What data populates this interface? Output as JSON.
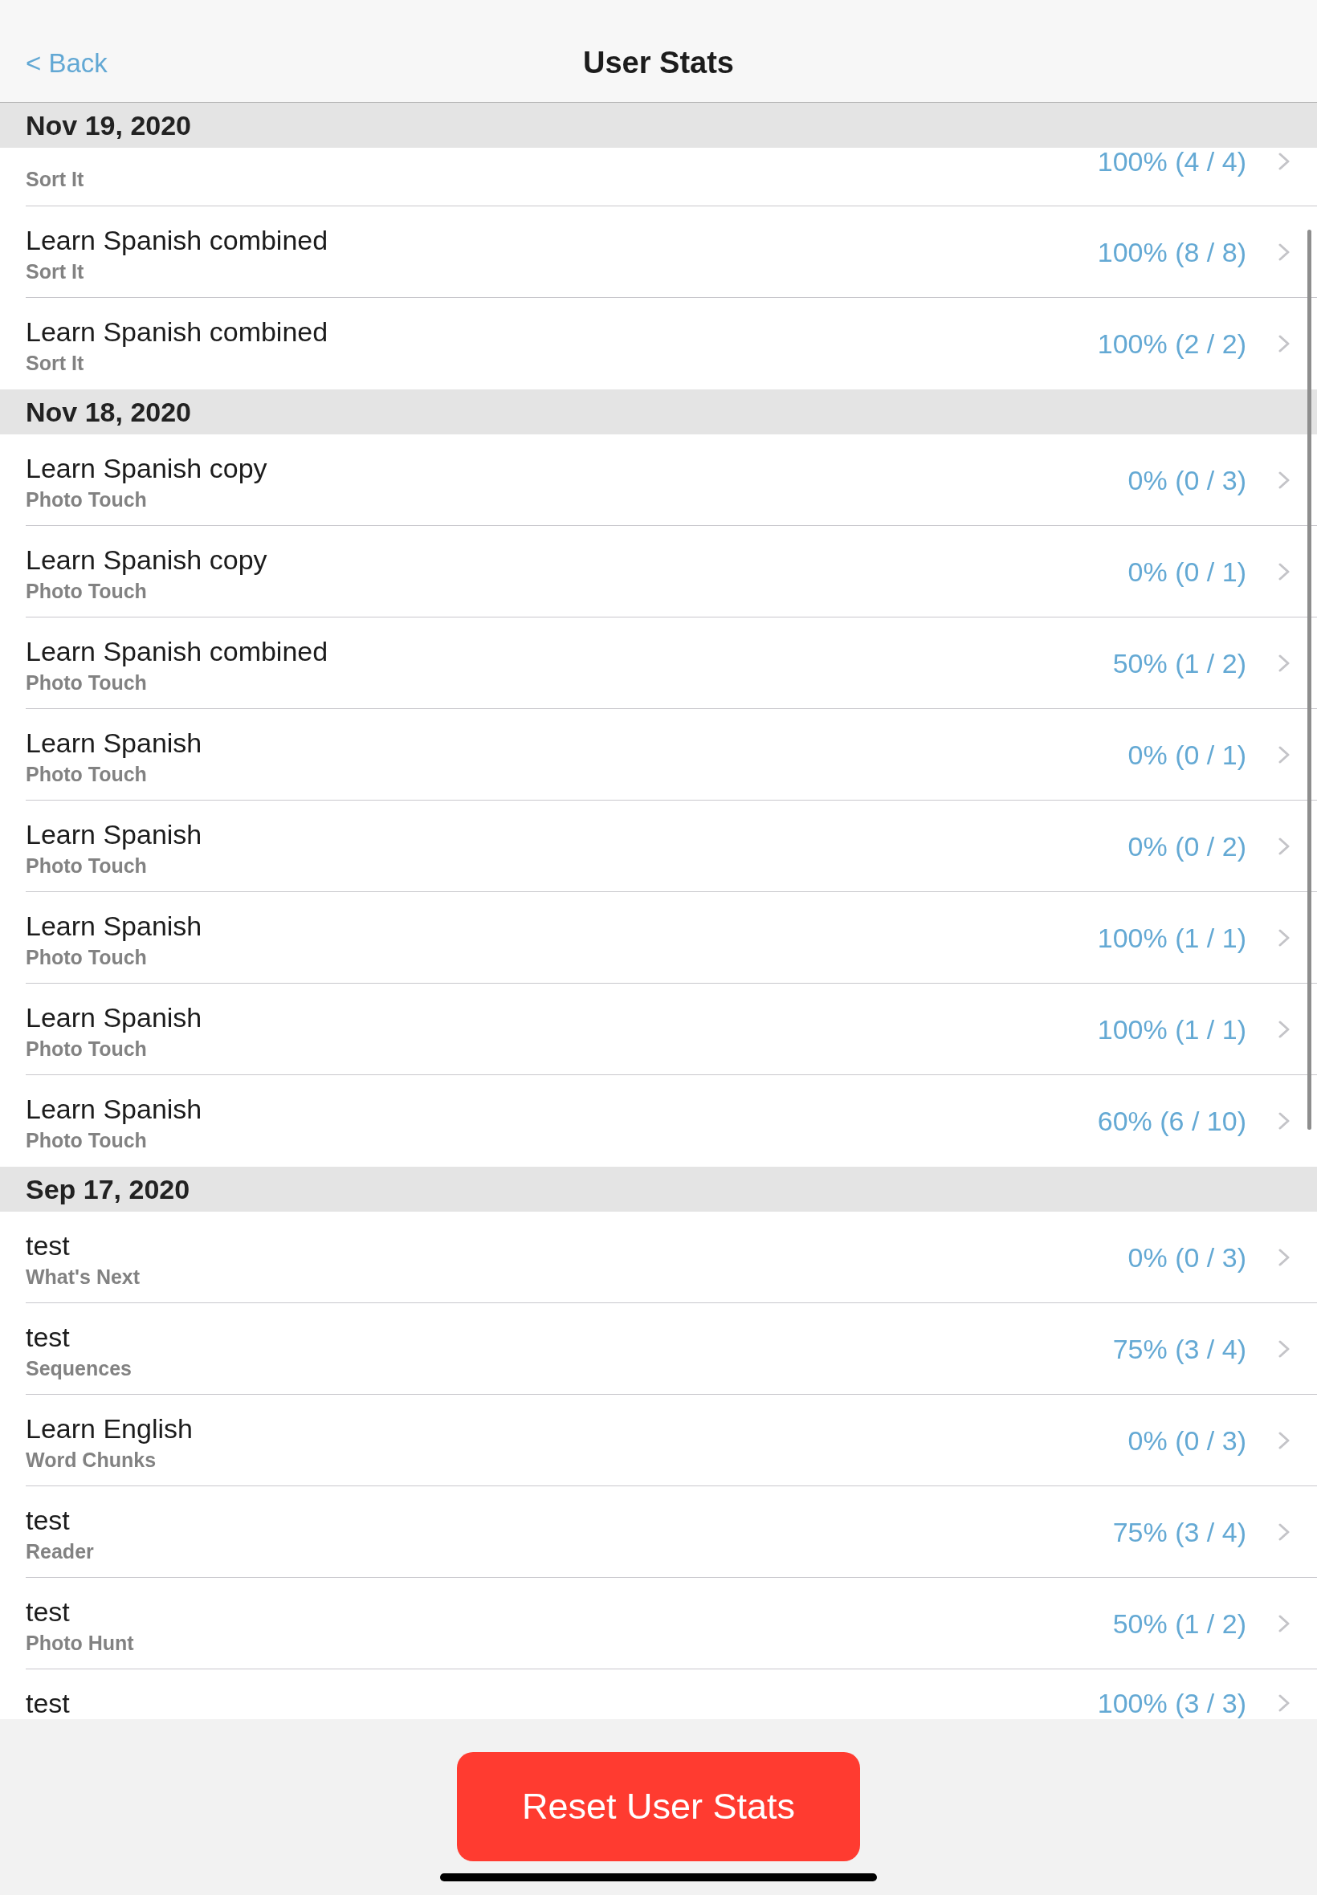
{
  "nav": {
    "back": "< Back",
    "title": "User Stats"
  },
  "sections": [
    {
      "date": "Nov 19, 2020",
      "rows": [
        {
          "subtitle": "Sort It",
          "score": "100% (4 / 4)"
        },
        {
          "title": "Learn Spanish combined",
          "subtitle": "Sort It",
          "score": "100% (8 / 8)"
        },
        {
          "title": "Learn Spanish combined",
          "subtitle": "Sort It",
          "score": "100% (2 / 2)"
        }
      ]
    },
    {
      "date": "Nov 18, 2020",
      "rows": [
        {
          "title": "Learn Spanish copy",
          "subtitle": "Photo Touch",
          "score": "0% (0 / 3)"
        },
        {
          "title": "Learn Spanish copy",
          "subtitle": "Photo Touch",
          "score": "0% (0 / 1)"
        },
        {
          "title": "Learn Spanish combined",
          "subtitle": "Photo Touch",
          "score": "50% (1 / 2)"
        },
        {
          "title": "Learn Spanish",
          "subtitle": "Photo Touch",
          "score": "0% (0 / 1)"
        },
        {
          "title": "Learn Spanish",
          "subtitle": "Photo Touch",
          "score": "0% (0 / 2)"
        },
        {
          "title": "Learn Spanish",
          "subtitle": "Photo Touch",
          "score": "100% (1 / 1)"
        },
        {
          "title": "Learn Spanish",
          "subtitle": "Photo Touch",
          "score": "100% (1 / 1)"
        },
        {
          "title": "Learn Spanish",
          "subtitle": "Photo Touch",
          "score": "60% (6 / 10)"
        }
      ]
    },
    {
      "date": "Sep 17, 2020",
      "rows": [
        {
          "title": "test",
          "subtitle": "What's Next",
          "score": "0% (0 / 3)"
        },
        {
          "title": "test",
          "subtitle": "Sequences",
          "score": "75% (3 / 4)"
        },
        {
          "title": "Learn English",
          "subtitle": "Word Chunks",
          "score": "0% (0 / 3)"
        },
        {
          "title": "test",
          "subtitle": "Reader",
          "score": "75% (3 / 4)"
        },
        {
          "title": "test",
          "subtitle": "Photo Hunt",
          "score": "50% (1 / 2)"
        },
        {
          "title": "test",
          "score": "100% (3 / 3)"
        }
      ]
    }
  ],
  "footer": {
    "button": "Reset User Stats"
  }
}
